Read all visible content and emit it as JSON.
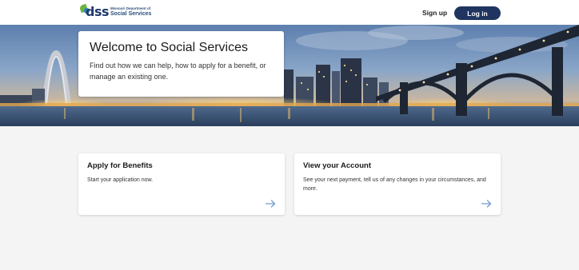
{
  "header": {
    "logo_mark": "dss",
    "logo_line1": "Missouri Department of",
    "logo_line2": "Social Services",
    "signup_label": "Sign up",
    "login_label": "Log in"
  },
  "hero": {
    "title": "Welcome to Social Services",
    "description": "Find out how we can help, how to apply for a benefit, or manage an existing one."
  },
  "cards": [
    {
      "title": "Apply for Benefits",
      "description": "Start your application now.",
      "icon": "arrow-right-icon"
    },
    {
      "title": "View your Account",
      "description": "See your next payment, tell us of any changes in your circumstances, and more.",
      "icon": "arrow-right-icon"
    }
  ],
  "colors": {
    "brand_navy": "#1f3560",
    "logo_green": "#6cb33f",
    "logo_blue": "#2d7fc1",
    "arrow_blue": "#6f9ccf",
    "page_bg": "#f4f4f4"
  }
}
